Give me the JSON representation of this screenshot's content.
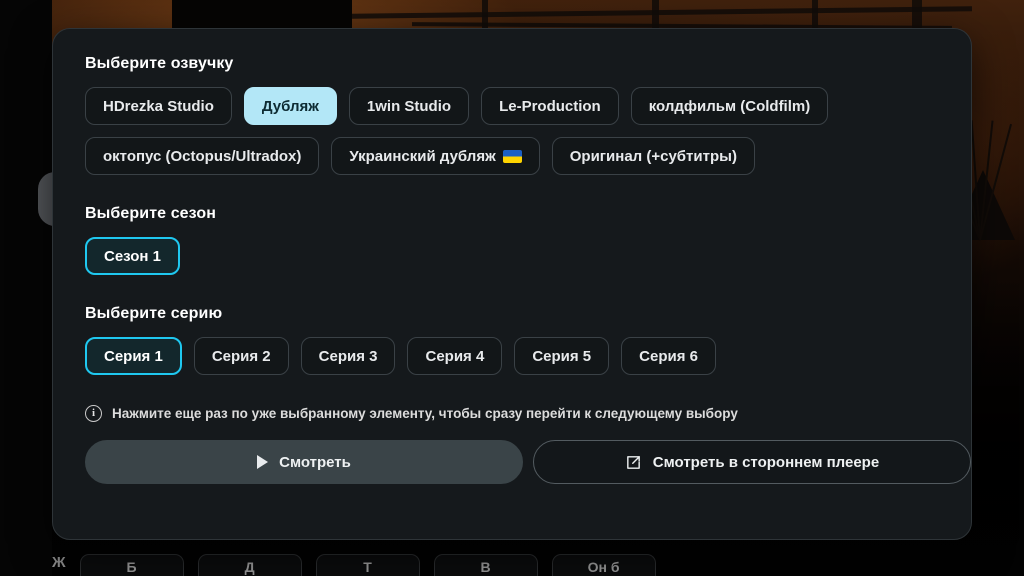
{
  "background": {
    "description": "dark western sunset artwork"
  },
  "carousel": {
    "prev_arrow_icon": "chevron-left-icon"
  },
  "modal": {
    "voice_section": {
      "title": "Выберите озвучку",
      "options": [
        {
          "label": "HDrezka Studio",
          "state": "default"
        },
        {
          "label": "Дубляж",
          "state": "selected-fill"
        },
        {
          "label": "1win Studio",
          "state": "default"
        },
        {
          "label": "Le-Production",
          "state": "default"
        },
        {
          "label": "колдфильм (Coldfilm)",
          "state": "default"
        },
        {
          "label": "октопус (Octopus/Ultradox)",
          "state": "default"
        },
        {
          "label": "Украинский дубляж",
          "state": "default",
          "flag": "ukraine-flag-icon"
        },
        {
          "label": "Оригинал (+субтитры)",
          "state": "default"
        }
      ]
    },
    "season_section": {
      "title": "Выберите сезон",
      "options": [
        {
          "label": "Сезон 1",
          "state": "selected-outline"
        }
      ]
    },
    "episode_section": {
      "title": "Выберите серию",
      "options": [
        {
          "label": "Серия 1",
          "state": "selected-outline"
        },
        {
          "label": "Серия 2",
          "state": "default"
        },
        {
          "label": "Серия 3",
          "state": "default"
        },
        {
          "label": "Серия 4",
          "state": "default"
        },
        {
          "label": "Серия 5",
          "state": "default"
        },
        {
          "label": "Серия 6",
          "state": "default"
        }
      ]
    },
    "hint": {
      "icon": "info-icon",
      "text": "Нажмите еще раз по уже выбранному элементу, чтобы сразу перейти к следующему выбору"
    },
    "actions": {
      "watch": {
        "label": "Смотреть",
        "icon": "play-icon"
      },
      "external": {
        "label": "Смотреть в стороннем плеере",
        "icon": "external-link-icon"
      }
    }
  },
  "bottom_row": {
    "label": "Ж",
    "chips": [
      "Б",
      "Д",
      "Т",
      "В",
      "Он б"
    ]
  },
  "colors": {
    "accent_cyan": "#1fc8f0",
    "selected_fill": "#b3e7f7",
    "modal_bg": "#15191c",
    "chip_bg": "#121618",
    "primary_action_bg": "#3a4448"
  }
}
